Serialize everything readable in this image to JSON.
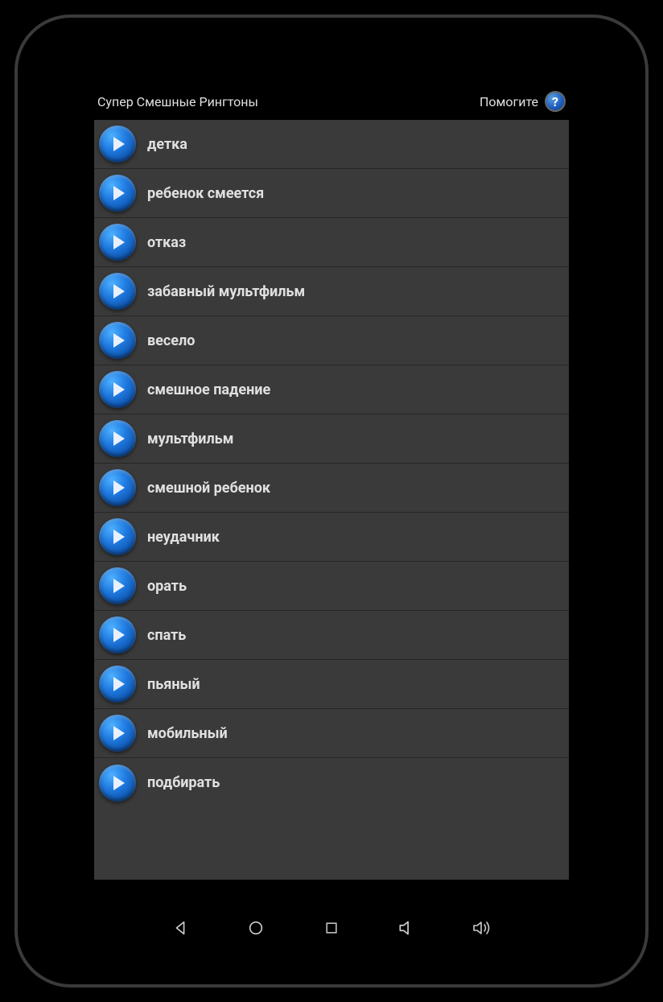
{
  "header": {
    "title": "Супер Смешные Рингтоны",
    "help_label": "Помогите",
    "help_icon_text": "?"
  },
  "ringtones": [
    {
      "label": "детка"
    },
    {
      "label": "ребенок смеется"
    },
    {
      "label": "отказ"
    },
    {
      "label": "забавный мультфильм"
    },
    {
      "label": "весело"
    },
    {
      "label": "смешное падение"
    },
    {
      "label": "мультфильм"
    },
    {
      "label": "смешной ребенок"
    },
    {
      "label": "неудачник"
    },
    {
      "label": "орать"
    },
    {
      "label": "спать"
    },
    {
      "label": "пьяный"
    },
    {
      "label": "мобильный"
    },
    {
      "label": "подбирать"
    }
  ]
}
